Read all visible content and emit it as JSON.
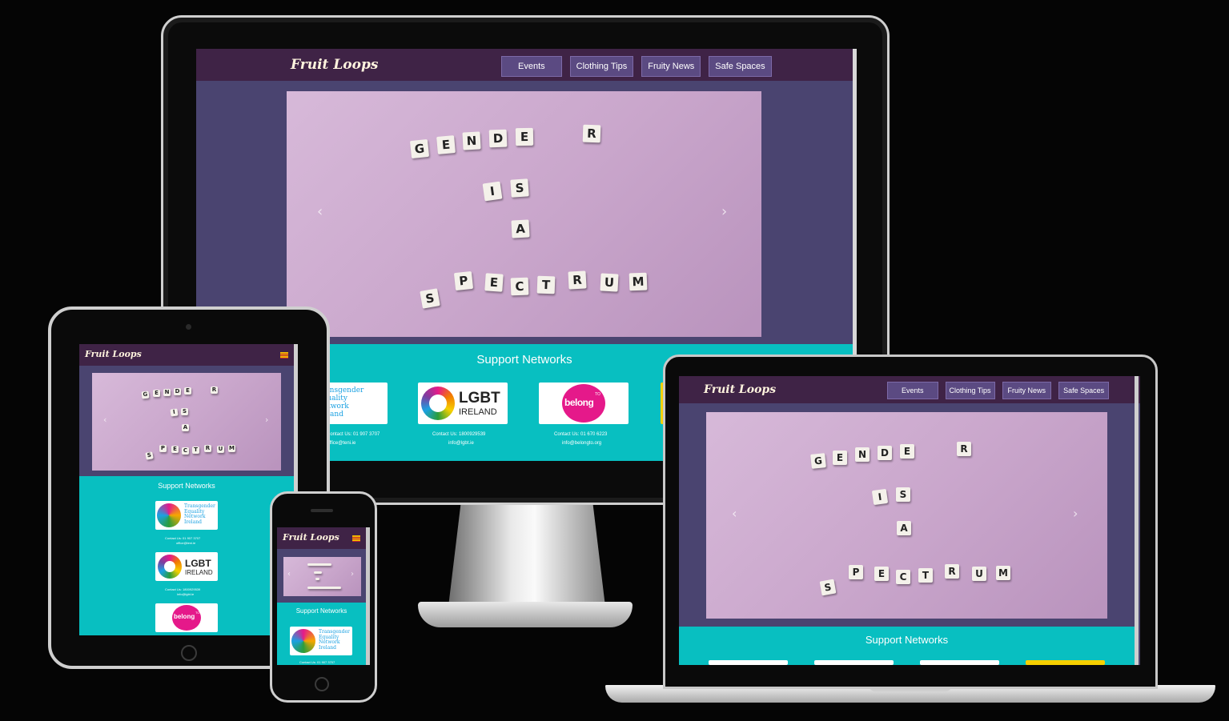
{
  "site": {
    "brand": "Fruit Loops",
    "nav": [
      "Events",
      "Clothing Tips",
      "Fruity News",
      "Safe Spaces"
    ],
    "carousel": {
      "words": [
        "GENDER",
        "IS",
        "A",
        "SPECTRUM"
      ],
      "prev_icon": "chevron-left-icon",
      "next_icon": "chevron-right-icon"
    },
    "support": {
      "title": "Support Networks",
      "networks": [
        {
          "name": "Transgender Equality Network Ireland",
          "logo_lines": [
            "Transgender",
            "Equality",
            "Network",
            "Ireland"
          ],
          "contact": "Contact Us: 01 907 3707",
          "email": "office@teni.ie"
        },
        {
          "name": "LGBT IRELAND",
          "logo_main": "LGBT",
          "logo_sub": "IRELAND",
          "contact": "Contact Us: 1800929539",
          "email": "info@lgbt.ie"
        },
        {
          "name": "BeLonG To",
          "logo_text": "belong",
          "logo_sup": "TO",
          "contact": "Contact Us: 01 670 6223",
          "email": "info@belongto.org"
        },
        {
          "name": "Yellow card",
          "contact": "",
          "email": ""
        }
      ]
    }
  },
  "colors": {
    "background": "#050505",
    "nav": "#3f2346",
    "page": "#4a4470",
    "nav_button": "#5b4a82",
    "support": "#08bfc1",
    "brand_text": "#fff3de",
    "belong_pink": "#e5198a"
  }
}
